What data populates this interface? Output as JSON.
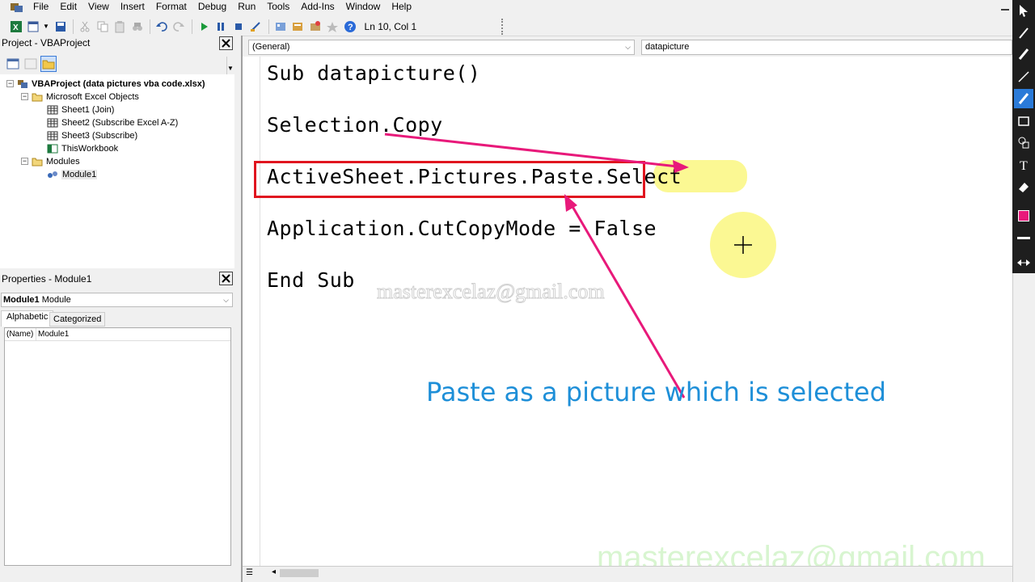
{
  "menu": {
    "items": [
      "File",
      "Edit",
      "View",
      "Insert",
      "Format",
      "Debug",
      "Run",
      "Tools",
      "Add-Ins",
      "Window",
      "Help"
    ]
  },
  "toolbar": {
    "position": "Ln 10, Col 1"
  },
  "project": {
    "title": "Project - VBAProject",
    "root": "VBAProject (data pictures vba code.xlsx)",
    "excel_objects": "Microsoft Excel Objects",
    "sheets": [
      "Sheet1 (Join)",
      "Sheet2 (Subscribe Excel A-Z)",
      "Sheet3 (Subscribe)",
      "ThisWorkbook"
    ],
    "modules_folder": "Modules",
    "module": "Module1"
  },
  "properties": {
    "title": "Properties - Module1",
    "object_name": "Module1",
    "object_type": "Module",
    "tab_alphabetic": "Alphabetic",
    "tab_categorized": "Categorized",
    "row_name": "(Name)",
    "row_value": "Module1"
  },
  "editor": {
    "object_dropdown": "(General)",
    "proc_dropdown": "datapicture",
    "lines": {
      "l1": "Sub datapicture()",
      "l2": "Selection.Copy",
      "l3a": "ActiveSheet.Pictures.Paste",
      "l3b": ".",
      "l3c": "Select",
      "l4": "Application.CutCopyMode = False",
      "l5": "End Sub"
    }
  },
  "annotations": {
    "note": "Paste as a picture which is selected",
    "watermark_center": "masterexcelaz@gmail.com",
    "watermark_corner": "masterexcelaz@gmail.com",
    "note_color": "#1e8fd8",
    "arrow_color": "#e8197a",
    "box_color": "#e0151f",
    "highlight_color": "#f7f23a"
  }
}
